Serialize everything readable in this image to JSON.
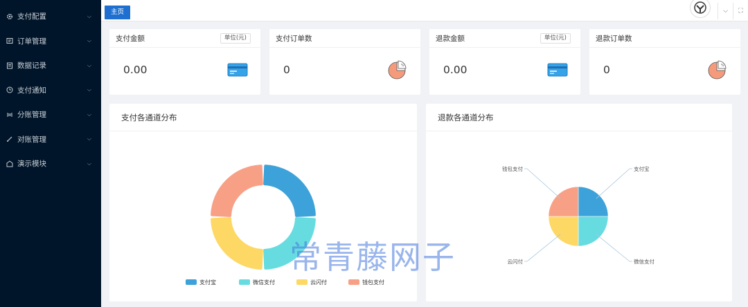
{
  "sidebar": {
    "items": [
      {
        "label": "支付配置",
        "icon": "gear-icon"
      },
      {
        "label": "订单管理",
        "icon": "order-icon"
      },
      {
        "label": "数据记录",
        "icon": "record-icon"
      },
      {
        "label": "支付通知",
        "icon": "clock-icon"
      },
      {
        "label": "分账管理",
        "icon": "split-icon"
      },
      {
        "label": "对账管理",
        "icon": "reconcile-icon"
      },
      {
        "label": "演示模块",
        "icon": "demo-icon"
      }
    ]
  },
  "tabs": {
    "home": "主页"
  },
  "stats": [
    {
      "title": "支付金额",
      "unit": "单位(元)",
      "value": "0.00",
      "icon": "card-icon"
    },
    {
      "title": "支付订单数",
      "value": "0",
      "icon": "pie-chart-icon"
    },
    {
      "title": "退款金额",
      "unit": "单位(元)",
      "value": "0.00",
      "icon": "card-icon"
    },
    {
      "title": "退款订单数",
      "value": "0",
      "icon": "pie-chart-icon"
    }
  ],
  "pay_chart": {
    "title": "支付各通道分布",
    "chart_data": {
      "type": "pie",
      "variant": "donut",
      "categories": [
        "支付宝",
        "微信支付",
        "云闪付",
        "钱包支付"
      ],
      "values": [
        1,
        1,
        1,
        1
      ],
      "legend": "bottom"
    }
  },
  "refund_chart": {
    "title": "退款各通道分布",
    "chart_data": {
      "type": "pie",
      "categories": [
        "支付宝",
        "微信支付",
        "云闪付",
        "钱包支付"
      ],
      "values": [
        1,
        1,
        1,
        1
      ],
      "legend": "none"
    }
  },
  "colors": {
    "alipay": "#3da2d9",
    "wechat": "#67dce0",
    "unionpay": "#fdd865",
    "wallet": "#f8a086",
    "brand": "#1e6fd0",
    "sidebar": "#001529"
  },
  "watermark": "常青藤网子"
}
